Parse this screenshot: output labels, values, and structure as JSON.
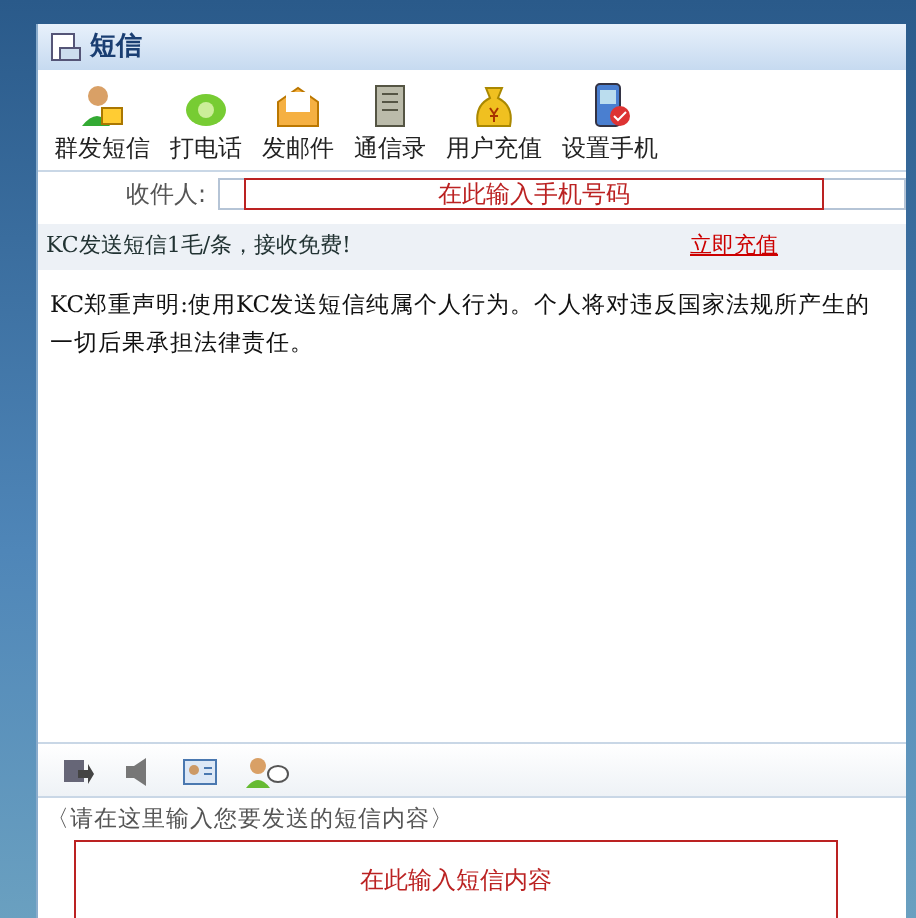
{
  "window": {
    "title": "短信"
  },
  "toolbar": [
    {
      "label": "群发短信"
    },
    {
      "label": "打电话"
    },
    {
      "label": "发邮件"
    },
    {
      "label": "通信录"
    },
    {
      "label": "用户充值"
    },
    {
      "label": "设置手机"
    }
  ],
  "recipient": {
    "label": "收件人:",
    "annotation": "在此输入手机号码"
  },
  "promo": {
    "text": "KC发送短信1毛/条，接收免费!",
    "link": "立即充值"
  },
  "notice": "KC郑重声明:使用KC发送短信纯属个人行为。个人将对违反国家法规所产生的一切后果承担法律责任。",
  "message": {
    "placeholder": "〈请在这里输入您要发送的短信内容〉",
    "annotation": "在此输入短信内容"
  }
}
